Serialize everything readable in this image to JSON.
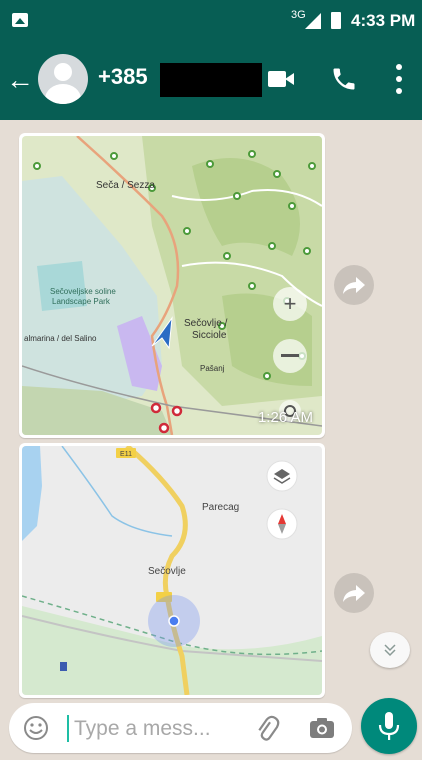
{
  "status_bar": {
    "network": "3G",
    "time": "4:33 PM"
  },
  "header": {
    "contact_name": "+385",
    "icons": [
      "back-arrow-icon",
      "avatar",
      "video-call-icon",
      "phone-icon",
      "more-vert-icon"
    ]
  },
  "messages": [
    {
      "type": "map",
      "time": "1:26 AM",
      "map_labels": [
        "Seča / Sezza",
        "Sečovlje / Sicciole",
        "Sečoveljske soline / Saline",
        "Landscape Park",
        "almarina / del Salino",
        "Pašanj"
      ]
    },
    {
      "type": "map",
      "road_label": "E11",
      "map_labels": [
        "Parecag",
        "Sečovlje"
      ]
    }
  ],
  "input": {
    "placeholder": "Type a mess..."
  },
  "colors": {
    "header": "#075e54",
    "mic_button": "#00897b",
    "chat_background": "#e5ddd5"
  }
}
